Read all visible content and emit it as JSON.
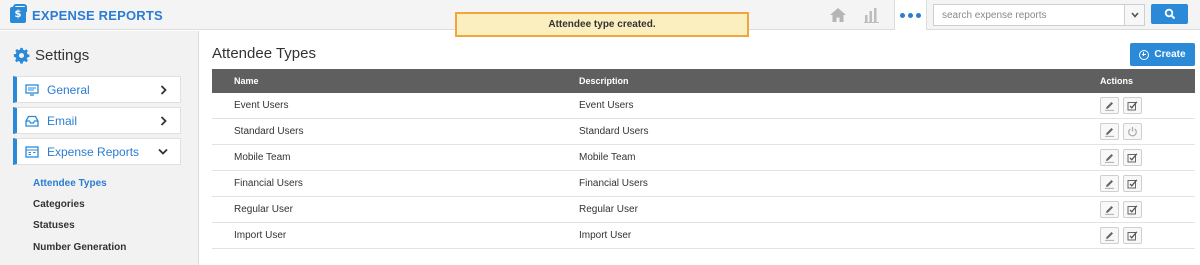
{
  "app": {
    "title": "EXPENSE REPORTS",
    "logo_icon": "briefcase-dollar-icon"
  },
  "toast": {
    "message": "Attendee type created."
  },
  "topbar": {
    "icons": [
      "home-icon",
      "bar-chart-icon",
      "more-dots-icon"
    ],
    "search": {
      "placeholder": "search expense reports",
      "value": ""
    }
  },
  "sidebar": {
    "heading": "Settings",
    "items": [
      {
        "label": "General",
        "icon": "monitor-icon",
        "chevron": "chevron-right-icon"
      },
      {
        "label": "Email",
        "icon": "inbox-icon",
        "chevron": "chevron-right-icon"
      },
      {
        "label": "Expense Reports",
        "icon": "report-icon",
        "chevron": "chevron-down-icon"
      }
    ],
    "subitems": [
      "Attendee Types",
      "Categories",
      "Statuses",
      "Number Generation"
    ],
    "active_subitem": "Attendee Types"
  },
  "main": {
    "title": "Attendee Types",
    "create_label": "Create",
    "columns": {
      "name": "Name",
      "description": "Description",
      "actions": "Actions"
    },
    "rows": [
      {
        "name": "Event Users",
        "description": "Event Users",
        "second_action": "check-edit-icon"
      },
      {
        "name": "Standard Users",
        "description": "Standard Users",
        "second_action": "power-icon"
      },
      {
        "name": "Mobile Team",
        "description": "Mobile Team",
        "second_action": "check-edit-icon"
      },
      {
        "name": "Financial Users",
        "description": "Financial Users",
        "second_action": "check-edit-icon"
      },
      {
        "name": "Regular User",
        "description": "Regular User",
        "second_action": "check-edit-icon"
      },
      {
        "name": "Import User",
        "description": "Import User",
        "second_action": "check-edit-icon"
      }
    ]
  },
  "colors": {
    "accent": "#2b8ad8",
    "toast_bg": "#fbefbf",
    "toast_border": "#f0a63a",
    "header_row": "#5f5f5f"
  }
}
